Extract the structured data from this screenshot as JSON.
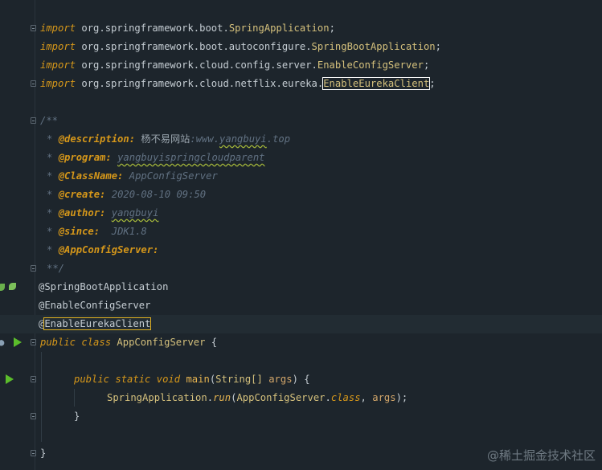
{
  "imports": [
    {
      "kw": "import",
      "pkg": "org.springframework.boot.",
      "cls": "SpringApplication",
      "end": ";"
    },
    {
      "kw": "import",
      "pkg": "org.springframework.boot.autoconfigure.",
      "cls": "SpringBootApplication",
      "end": ";"
    },
    {
      "kw": "import",
      "pkg": "org.springframework.cloud.config.server.",
      "cls": "EnableConfigServer",
      "end": ";"
    },
    {
      "kw": "import",
      "pkg": "org.springframework.cloud.netflix.eureka.",
      "cls": "EnableEurekaClient",
      "end": ";"
    }
  ],
  "doc": {
    "open": "/**",
    "star": "*",
    "close": "**/",
    "description_tag": "@description:",
    "description_cn": "杨不易网站",
    "description_sep": ":www.",
    "description_link": "yangbuyi",
    "description_end": ".top",
    "program_tag": "@program:",
    "program_val": "yangbuyispringcloudparent",
    "classname_tag": "@ClassName:",
    "classname_val": "AppConfigServer",
    "create_tag": "@create:",
    "create_val": "2020-08-10 09:50",
    "author_tag": "@author:",
    "author_val": "yangbuyi",
    "since_tag": "@since:",
    "since_val": "JDK1.8",
    "appconfig_tag": "@AppConfigServer:"
  },
  "annotations": {
    "a1": "@SpringBootApplication",
    "a2": "@EnableConfigServer",
    "a3_at": "@",
    "a3_name": "EnableEurekaClient"
  },
  "cls_decl": {
    "public": "public",
    "class": "class",
    "name": "AppConfigServer",
    "brace": " {"
  },
  "main_decl": {
    "public": "public",
    "static": "static",
    "void": "void",
    "name": "main",
    "open": "(",
    "type": "String[]",
    "param": "args",
    "close": ") {"
  },
  "body": {
    "cls": "SpringApplication",
    "dot": ".",
    "method": "run",
    "open": "(",
    "arg_cls": "AppConfigServer",
    "arg_dot": ".",
    "arg_kw": "class",
    "comma": ", ",
    "arg": "args",
    "close": ");"
  },
  "close_inner": "}",
  "close_outer": "}",
  "watermark": "@稀土掘金技术社区"
}
